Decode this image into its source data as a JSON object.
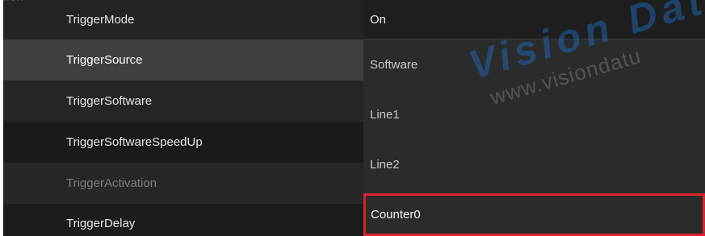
{
  "properties": [
    {
      "label": "TriggerMode",
      "bg": "#232323"
    },
    {
      "label": "TriggerSource",
      "bg": "#3f3f3f"
    },
    {
      "label": "TriggerSoftware",
      "bg": "#252525"
    },
    {
      "label": "TriggerSoftwareSpeedUp",
      "bg": "#1a1a1a"
    },
    {
      "label": "TriggerActivation",
      "bg": "#262626"
    },
    {
      "label": "TriggerDelay",
      "bg": "#1c1c1c"
    }
  ],
  "selected_value": "On",
  "dropdown": {
    "options": [
      "Software",
      "Line1",
      "Line2",
      "Counter0"
    ],
    "highlighted_index": 3,
    "highlight_color": "#d9232e"
  },
  "watermark": {
    "big": "Vision Dat",
    "small": "www.visiondatu",
    "corner": "sion"
  }
}
